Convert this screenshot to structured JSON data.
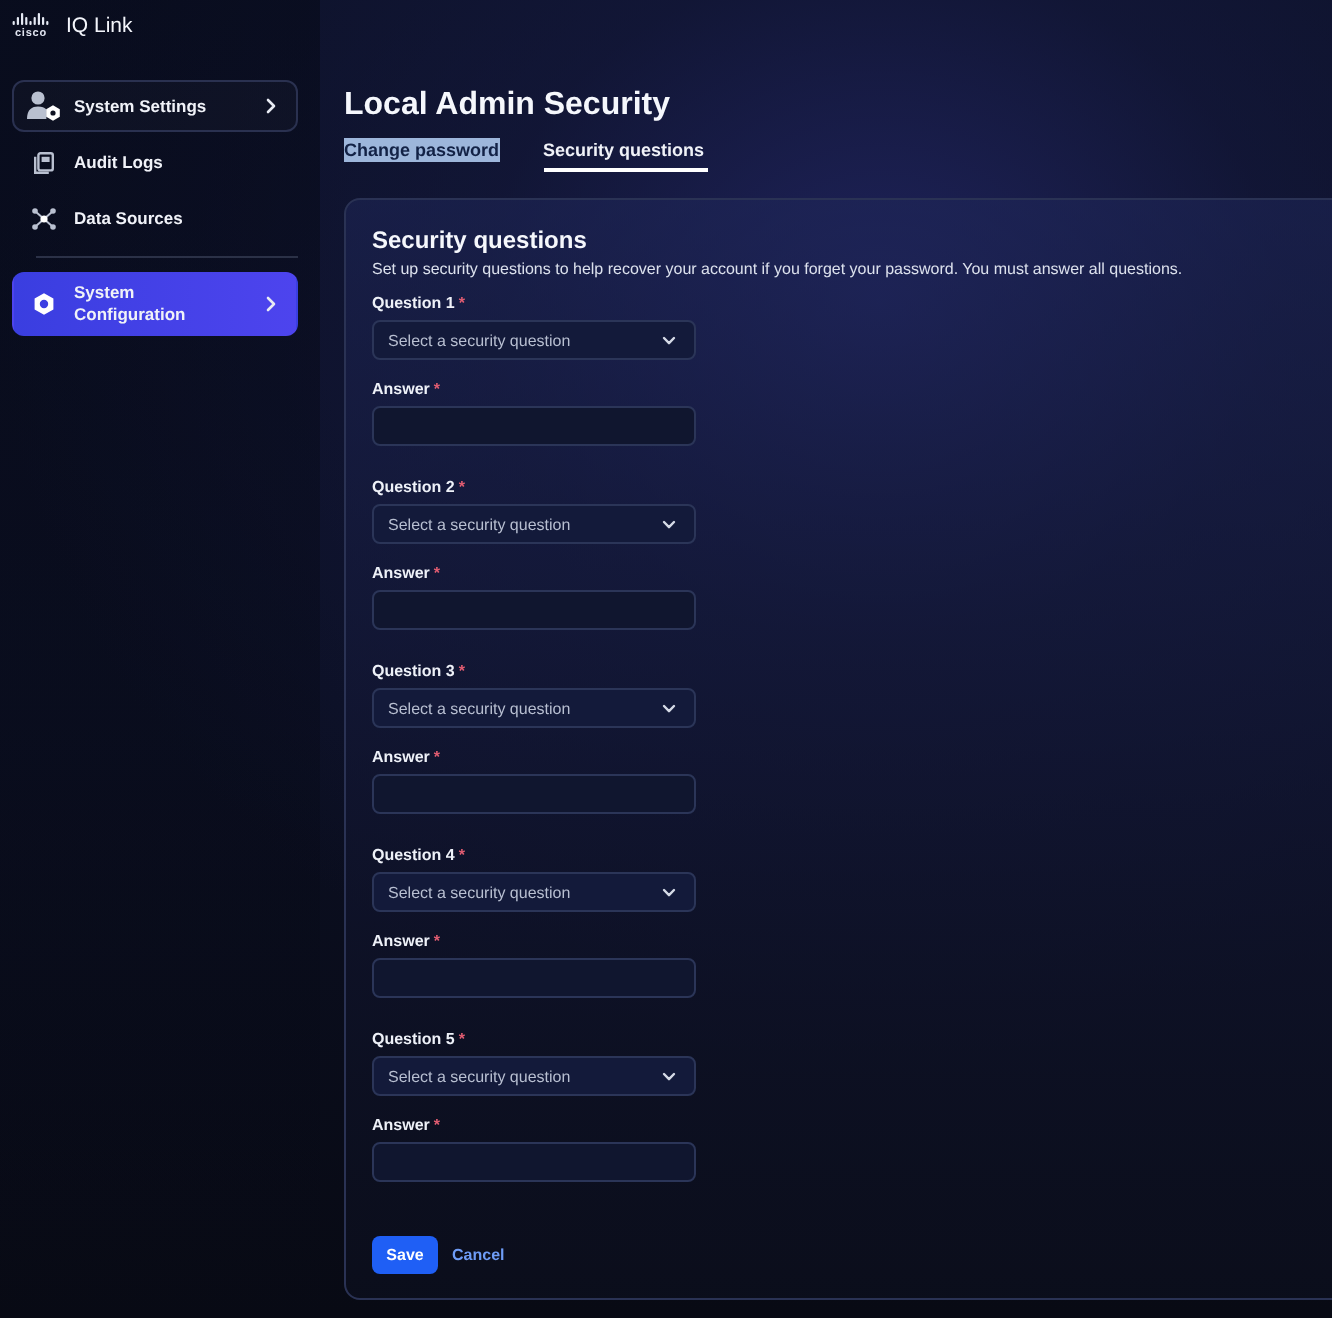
{
  "app": {
    "logo_text": "cisco",
    "name": "IQ Link"
  },
  "sidebar": {
    "groups": [
      {
        "items": [
          {
            "label": "System Settings",
            "expandable": true,
            "focused": true,
            "selected": false
          },
          {
            "label": "Audit Logs",
            "expandable": false,
            "focused": false,
            "selected": false
          },
          {
            "label": "Data Sources",
            "expandable": false,
            "focused": false,
            "selected": false
          }
        ]
      },
      {
        "items": [
          {
            "label": "System Configuration",
            "expandable": true,
            "focused": false,
            "selected": true
          }
        ]
      }
    ]
  },
  "page": {
    "title": "Local Admin Security"
  },
  "tabs": [
    {
      "label": "Change password",
      "selected": false,
      "highlighted": true
    },
    {
      "label": "Security questions",
      "selected": true,
      "highlighted": false
    }
  ],
  "form": {
    "title": "Security questions",
    "description": "Set up security questions to help recover your account if you forget your password. You must answer all questions.",
    "questions": [
      {
        "question": {
          "label": "Question 1",
          "required_mark": "*",
          "placeholder": "Select a security question"
        },
        "answer": {
          "label": "Answer",
          "required_mark": "*"
        }
      },
      {
        "question": {
          "label": "Question 2",
          "required_mark": "*",
          "placeholder": "Select a security question"
        },
        "answer": {
          "label": "Answer",
          "required_mark": "*"
        }
      },
      {
        "question": {
          "label": "Question 3",
          "required_mark": "*",
          "placeholder": "Select a security question"
        },
        "answer": {
          "label": "Answer",
          "required_mark": "*"
        }
      },
      {
        "question": {
          "label": "Question 4",
          "required_mark": "*",
          "placeholder": "Select a security question"
        },
        "answer": {
          "label": "Answer",
          "required_mark": "*"
        }
      },
      {
        "question": {
          "label": "Question 5",
          "required_mark": "*",
          "placeholder": "Select a security question"
        },
        "answer": {
          "label": "Answer",
          "required_mark": "*"
        }
      }
    ],
    "buttons": [
      {
        "label": "Save",
        "kind": "primary"
      },
      {
        "label": "Cancel",
        "kind": "link"
      }
    ]
  }
}
